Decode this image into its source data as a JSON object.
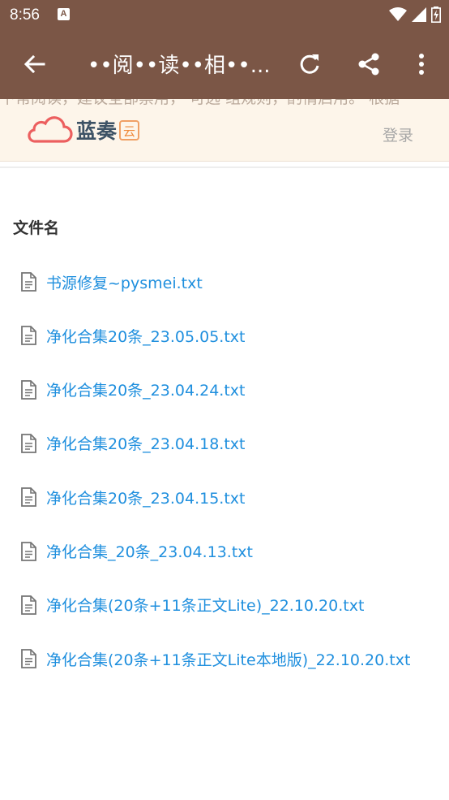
{
  "status_bar": {
    "time": "8:56",
    "notification_icon": "A"
  },
  "toolbar": {
    "title": "••阅••读••相••..."
  },
  "site": {
    "behind_text": "下常阅读，建议全部禁用，  可选 组规则，酌情启用。 根据",
    "logo_text": "蓝奏",
    "logo_badge": "云",
    "login_label": "登录"
  },
  "file_list": {
    "heading": "文件名",
    "files": [
      "书源修复~pysmei.txt",
      "净化合集20条_23.05.05.txt",
      "净化合集20条_23.04.24.txt",
      "净化合集20条_23.04.18.txt",
      "净化合集20条_23.04.15.txt",
      "净化合集_20条_23.04.13.txt",
      "净化合集(20条+11条正文Lite)_22.10.20.txt",
      "净化合集(20条+11条正文Lite本地版)_22.10.20.txt"
    ]
  },
  "colors": {
    "toolbar_bg": "#7b5646",
    "link": "#1f8fde",
    "header_bg": "#fdf5ea"
  }
}
